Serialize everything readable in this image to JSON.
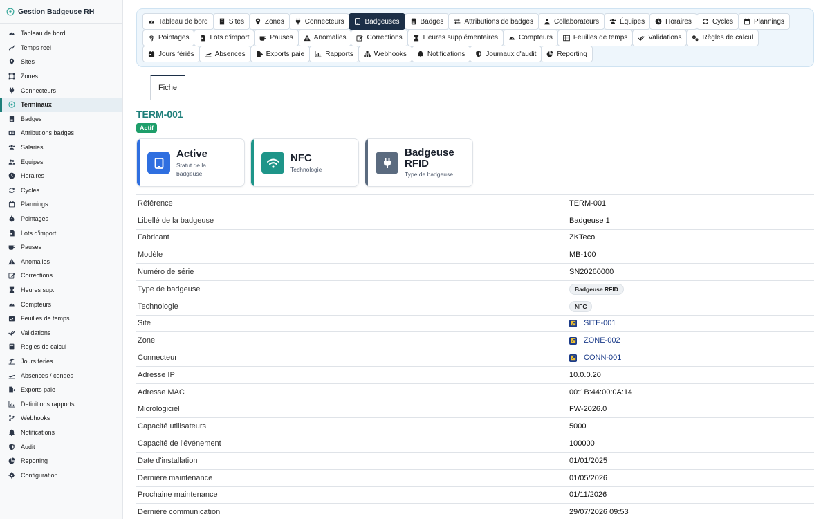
{
  "app": {
    "title": "Gestion Badgeuse RH",
    "brand_icon": "brain-icon"
  },
  "sidebar": {
    "items": [
      {
        "label": "Tableau de bord",
        "icon": "gauge-icon"
      },
      {
        "label": "Temps reel",
        "icon": "signal-icon"
      },
      {
        "label": "Sites",
        "icon": "map-pin-icon"
      },
      {
        "label": "Zones",
        "icon": "vector-square-icon"
      },
      {
        "label": "Connecteurs",
        "icon": "plug-icon"
      },
      {
        "label": "Terminaux",
        "icon": "brain-icon",
        "active": true
      },
      {
        "label": "Badges",
        "icon": "id-badge-icon"
      },
      {
        "label": "Attributions badges",
        "icon": "id-card-icon"
      },
      {
        "label": "Salaries",
        "icon": "users-icon"
      },
      {
        "label": "Equipes",
        "icon": "user-group-icon"
      },
      {
        "label": "Horaires",
        "icon": "clock-icon"
      },
      {
        "label": "Cycles",
        "icon": "sync-icon"
      },
      {
        "label": "Plannings",
        "icon": "calendar-icon"
      },
      {
        "label": "Pointages",
        "icon": "stopwatch-icon"
      },
      {
        "label": "Lots d'import",
        "icon": "file-import-icon"
      },
      {
        "label": "Pauses",
        "icon": "mug-icon"
      },
      {
        "label": "Anomalies",
        "icon": "warning-icon"
      },
      {
        "label": "Corrections",
        "icon": "edit-icon"
      },
      {
        "label": "Heures sup.",
        "icon": "hourglass-icon"
      },
      {
        "label": "Compteurs",
        "icon": "gauge-icon"
      },
      {
        "label": "Feuilles de temps",
        "icon": "calendar-check-icon"
      },
      {
        "label": "Validations",
        "icon": "check-double-icon"
      },
      {
        "label": "Regles de calcul",
        "icon": "calculator-icon"
      },
      {
        "label": "Jours feries",
        "icon": "umbrella-beach-icon"
      },
      {
        "label": "Absences / conges",
        "icon": "plane-icon"
      },
      {
        "label": "Exports paie",
        "icon": "file-export-icon"
      },
      {
        "label": "Definitions rapports",
        "icon": "chart-bar-icon"
      },
      {
        "label": "Webhooks",
        "icon": "code-branch-icon"
      },
      {
        "label": "Notifications",
        "icon": "bell-icon"
      },
      {
        "label": "Audit",
        "icon": "shield-icon"
      },
      {
        "label": "Reporting",
        "icon": "chart-pie-icon"
      },
      {
        "label": "Configuration",
        "icon": "gear-icon"
      }
    ]
  },
  "tabs": {
    "rows": [
      [
        {
          "label": "Tableau de bord",
          "icon": "gauge-icon"
        },
        {
          "label": "Sites",
          "icon": "building-icon"
        },
        {
          "label": "Zones",
          "icon": "map-pin-icon"
        },
        {
          "label": "Connecteurs",
          "icon": "plug-icon"
        },
        {
          "label": "Badgeuses",
          "icon": "tablet-icon",
          "active": true
        },
        {
          "label": "Badges",
          "icon": "id-badge-icon"
        },
        {
          "label": "Attributions de badges",
          "icon": "exchange-icon"
        },
        {
          "label": "Collaborateurs",
          "icon": "user-icon"
        },
        {
          "label": "Équipes",
          "icon": "users-icon"
        },
        {
          "label": "Horaires",
          "icon": "clock-icon"
        },
        {
          "label": "Cycles",
          "icon": "sync-icon"
        },
        {
          "label": "Plannings",
          "icon": "calendar-icon"
        }
      ],
      [
        {
          "label": "Pointages",
          "icon": "fingerprint-icon"
        },
        {
          "label": "Lots d'import",
          "icon": "file-import-icon"
        },
        {
          "label": "Pauses",
          "icon": "mug-icon"
        },
        {
          "label": "Anomalies",
          "icon": "warning-icon"
        },
        {
          "label": "Corrections",
          "icon": "edit-icon"
        },
        {
          "label": "Heures supplémentaires",
          "icon": "hourglass-icon"
        },
        {
          "label": "Compteurs",
          "icon": "gauge-icon"
        },
        {
          "label": "Feuilles de temps",
          "icon": "table-icon"
        },
        {
          "label": "Validations",
          "icon": "check-double-icon"
        },
        {
          "label": "Règles de calcul",
          "icon": "gears-icon"
        }
      ],
      [
        {
          "label": "Jours fériés",
          "icon": "calendar-day-icon"
        },
        {
          "label": "Absences",
          "icon": "plane-icon"
        },
        {
          "label": "Exports paie",
          "icon": "file-export-icon"
        },
        {
          "label": "Rapports",
          "icon": "chart-bar-icon"
        },
        {
          "label": "Webhooks",
          "icon": "sitemap-icon"
        },
        {
          "label": "Notifications",
          "icon": "bell-icon"
        },
        {
          "label": "Journaux d'audit",
          "icon": "shield-icon"
        },
        {
          "label": "Reporting",
          "icon": "chart-pie-icon"
        }
      ]
    ]
  },
  "subtab": {
    "label": "Fiche"
  },
  "record": {
    "title": "TERM-001",
    "status": "Actif"
  },
  "cards": [
    {
      "value": "Active",
      "subtitle": "Statut de la badgeuse",
      "icon": "tablet-icon"
    },
    {
      "value": "NFC",
      "subtitle": "Technologie",
      "icon": "wifi-icon"
    },
    {
      "value": "Badgeuse RFID",
      "subtitle": "Type de badgeuse",
      "icon": "plug-icon"
    }
  ],
  "details": [
    {
      "label": "Référence",
      "value": "TERM-001"
    },
    {
      "label": "Libellé de la badgeuse",
      "value": "Badgeuse 1"
    },
    {
      "label": "Fabricant",
      "value": "ZKTeco"
    },
    {
      "label": "Modèle",
      "value": "MB-100"
    },
    {
      "label": "Numéro de série",
      "value": "SN20260000"
    },
    {
      "label": "Type de badgeuse",
      "value": "Badgeuse RFID",
      "kind": "pill"
    },
    {
      "label": "Technologie",
      "value": "NFC",
      "kind": "pill"
    },
    {
      "label": "Site",
      "value": "SITE-001",
      "kind": "link"
    },
    {
      "label": "Zone",
      "value": "ZONE-002",
      "kind": "link"
    },
    {
      "label": "Connecteur",
      "value": "CONN-001",
      "kind": "link"
    },
    {
      "label": "Adresse IP",
      "value": "10.0.0.20"
    },
    {
      "label": "Adresse MAC",
      "value": "00:1B:44:00:0A:14"
    },
    {
      "label": "Micrologiciel",
      "value": "FW-2026.0"
    },
    {
      "label": "Capacité utilisateurs",
      "value": "5000"
    },
    {
      "label": "Capacité de l'événement",
      "value": "100000"
    },
    {
      "label": "Date d'installation",
      "value": "01/01/2025"
    },
    {
      "label": "Dernière maintenance",
      "value": "01/05/2026"
    },
    {
      "label": "Prochaine maintenance",
      "value": "01/11/2026"
    },
    {
      "label": "Dernière communication",
      "value": "29/07/2026 09:53"
    }
  ],
  "colors": {
    "accent": "#1e7f7a",
    "active_tab": "#1c2f47",
    "status_green": "#1e9e6a",
    "link": "#1c3c8a"
  }
}
